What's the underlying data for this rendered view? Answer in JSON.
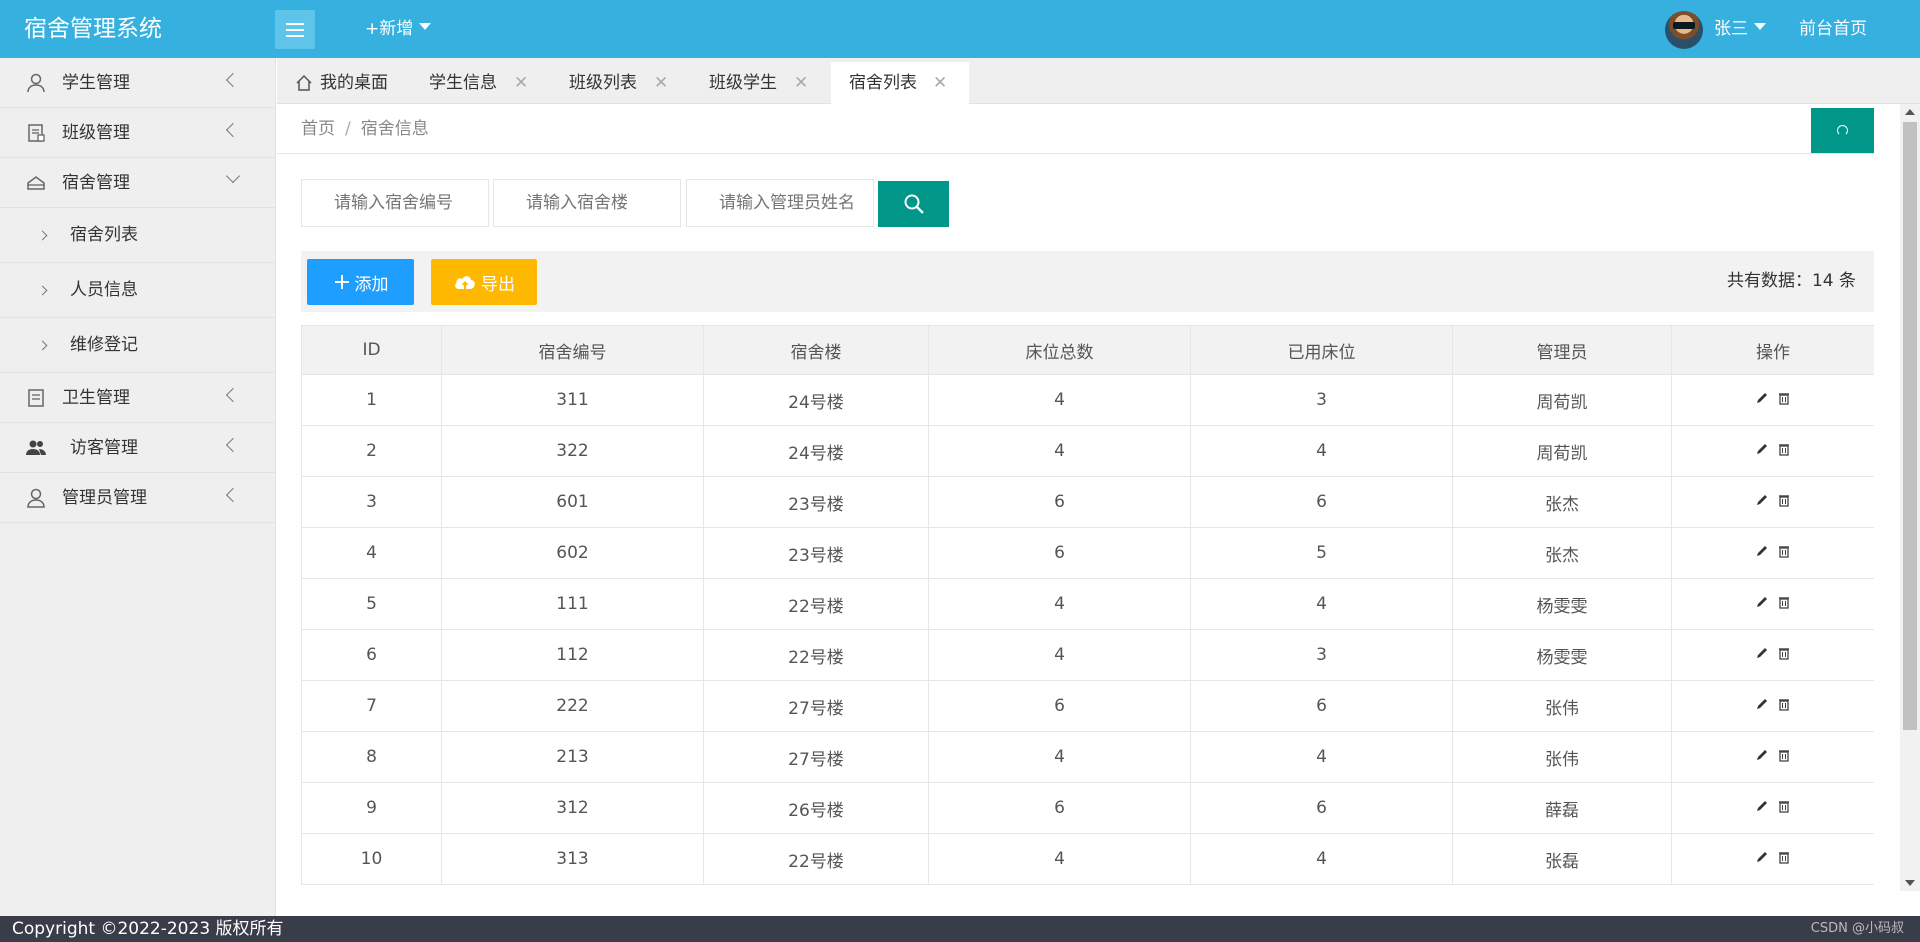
{
  "header": {
    "brand": "宿舍管理系统",
    "add_new": "+新增",
    "user_name": "张三",
    "front_home": "前台首页"
  },
  "sidebar": {
    "items": [
      {
        "label": "学生管理",
        "icon": "user-icon",
        "expanded": false
      },
      {
        "label": "班级管理",
        "icon": "class-icon",
        "expanded": false
      },
      {
        "label": "宿舍管理",
        "icon": "dorm-icon",
        "expanded": true
      },
      {
        "label": "卫生管理",
        "icon": "hygiene-icon",
        "expanded": false
      },
      {
        "label": "访客管理",
        "icon": "visitors-icon",
        "expanded": false
      },
      {
        "label": "管理员管理",
        "icon": "admin-icon",
        "expanded": false
      }
    ],
    "sub_items": [
      "宿舍列表",
      "人员信息",
      "维修登记"
    ]
  },
  "tabs": [
    {
      "label": "我的桌面",
      "closable": false,
      "active": false
    },
    {
      "label": "学生信息",
      "closable": true,
      "active": false
    },
    {
      "label": "班级列表",
      "closable": true,
      "active": false
    },
    {
      "label": "班级学生",
      "closable": true,
      "active": false
    },
    {
      "label": "宿舍列表",
      "closable": true,
      "active": true
    }
  ],
  "tab_close_symbol": "✕",
  "breadcrumb": {
    "home": "首页",
    "separator": "/",
    "current": "宿舍信息"
  },
  "search": {
    "dorm_no_placeholder": "请输入宿舍编号",
    "building_placeholder": "请输入宿舍楼",
    "manager_placeholder": "请输入管理员姓名"
  },
  "toolbar": {
    "add_label": "添加",
    "export_label": "导出",
    "total_label": "共有数据：",
    "total_count": "14",
    "total_unit": "条"
  },
  "table": {
    "headers": [
      "ID",
      "宿舍编号",
      "宿舍楼",
      "床位总数",
      "已用床位",
      "管理员",
      "操作"
    ],
    "rows": [
      [
        "1",
        "311",
        "24号楼",
        "4",
        "3",
        "周荀凯"
      ],
      [
        "2",
        "322",
        "24号楼",
        "4",
        "4",
        "周荀凯"
      ],
      [
        "3",
        "601",
        "23号楼",
        "6",
        "6",
        "张杰"
      ],
      [
        "4",
        "602",
        "23号楼",
        "6",
        "5",
        "张杰"
      ],
      [
        "5",
        "111",
        "22号楼",
        "4",
        "4",
        "杨雯雯"
      ],
      [
        "6",
        "112",
        "22号楼",
        "4",
        "3",
        "杨雯雯"
      ],
      [
        "7",
        "222",
        "27号楼",
        "6",
        "6",
        "张伟"
      ],
      [
        "8",
        "213",
        "27号楼",
        "4",
        "4",
        "张伟"
      ],
      [
        "9",
        "312",
        "26号楼",
        "6",
        "6",
        "薛磊"
      ],
      [
        "10",
        "313",
        "22号楼",
        "4",
        "4",
        "张磊"
      ]
    ]
  },
  "footer": {
    "copyright": "Copyright ©2022-2023 版权所有",
    "watermark": "CSDN @小码叔"
  },
  "colors": {
    "header": "#36b0de",
    "primary": "#009688",
    "add": "#1e9fff",
    "export": "#ffb800",
    "footer": "#393d49"
  }
}
